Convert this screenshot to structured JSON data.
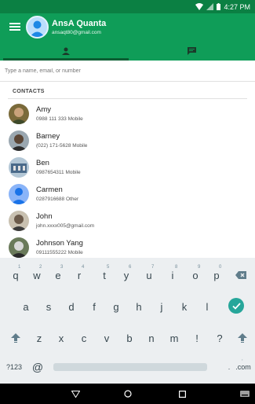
{
  "status_bar": {
    "time": "4:27 PM"
  },
  "account": {
    "name": "AnsA Quanta",
    "email": "ansaqt80@gmail.com"
  },
  "colors": {
    "primary": "#0f9d58",
    "primary_dark": "#0b8043",
    "accent": "#26a69a"
  },
  "search": {
    "placeholder": "Type a name, email, or number",
    "value": ""
  },
  "contacts": {
    "section_title": "CONTACTS",
    "items": [
      {
        "name": "Amy",
        "detail": "0988 111 333 Mobile"
      },
      {
        "name": "Barney",
        "detail": "(022) 171-5628 Mobile"
      },
      {
        "name": "Ben",
        "detail": "0987654311 Mobile"
      },
      {
        "name": "Carmen",
        "detail": "0287916688 Other"
      },
      {
        "name": "John",
        "detail": "john.xxxx005@gmail.com"
      },
      {
        "name": "Johnson Yang",
        "detail": "09111555222 Mobile"
      }
    ]
  },
  "keyboard": {
    "row1": [
      "q",
      "w",
      "e",
      "r",
      "t",
      "y",
      "u",
      "i",
      "o",
      "p"
    ],
    "row1_hints": [
      "1",
      "2",
      "3",
      "4",
      "5",
      "6",
      "7",
      "8",
      "9",
      "0"
    ],
    "row2": [
      "a",
      "s",
      "d",
      "f",
      "g",
      "h",
      "j",
      "k",
      "l"
    ],
    "row3": [
      "z",
      "x",
      "c",
      "v",
      "b",
      "n",
      "m",
      "!",
      "?"
    ],
    "symbols_label": "?123",
    "at_label": "@",
    "dotcom_label": ".com",
    "dotcom_hint": ",",
    "period_hint": "."
  }
}
